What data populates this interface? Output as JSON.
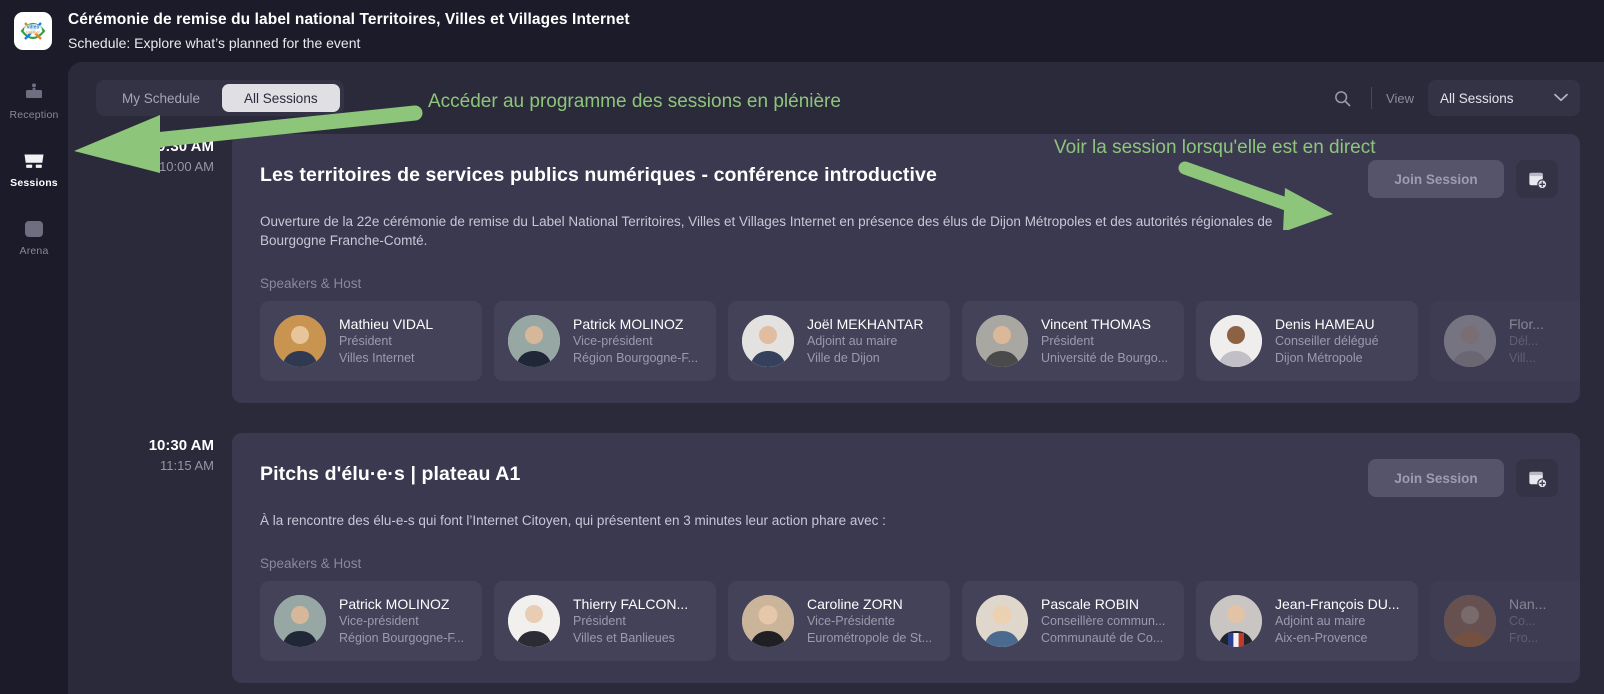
{
  "header": {
    "title": "Cérémonie de remise du label national Territoires, Villes et Villages Internet",
    "subtitle": "Schedule: Explore what’s planned for the event",
    "logo_alt": "villes-internet-logo"
  },
  "sidebar": {
    "items": [
      {
        "label": "Reception",
        "icon": "reception-desk-icon",
        "active": false
      },
      {
        "label": "Sessions",
        "icon": "presentation-screen-icon",
        "active": true
      },
      {
        "label": "Arena",
        "icon": "arena-icon",
        "active": false
      }
    ]
  },
  "toolbar": {
    "tabs": [
      {
        "label": "My Schedule",
        "active": false
      },
      {
        "label": "All Sessions",
        "active": true
      }
    ],
    "search_icon": "search-icon",
    "view_label": "View",
    "view_select": {
      "value": "All Sessions",
      "options": [
        "All Sessions"
      ]
    }
  },
  "annotations": [
    {
      "text": "Accéder au programme des sessions en plénière",
      "color": "#8dc57a"
    },
    {
      "text": "Voir la session lorsqu'elle est en direct",
      "color": "#8dc57a"
    }
  ],
  "sessions": [
    {
      "start_time": "09:30 AM",
      "end_time": "10:00 AM",
      "title": "Les territoires de services publics numériques - conférence introductive",
      "description": "Ouverture de la 22e cérémonie de remise du Label National Territoires, Villes et Villages Internet en présence des élus de Dijon Métropoles et des autorités régionales de Bourgogne Franche-Comté.",
      "join_label": "Join Session",
      "calendar_icon": "calendar-add-icon",
      "speakers_label": "Speakers & Host",
      "speakers": [
        {
          "name": "Mathieu VIDAL",
          "role": "Président",
          "org": "Villes Internet",
          "avatar": "#c9944f"
        },
        {
          "name": "Patrick MOLINOZ",
          "role": "Vice-président",
          "org": "Région Bourgogne-F...",
          "avatar": "#97a8a4"
        },
        {
          "name": "Joël MEKHANTAR",
          "role": "Adjoint au maire",
          "org": "Ville de Dijon",
          "avatar": "#e4e2e0"
        },
        {
          "name": "Vincent THOMAS",
          "role": "Président",
          "org": "Université de Bourgo...",
          "avatar": "#a9a7a2"
        },
        {
          "name": "Denis HAMEAU",
          "role": "Conseiller délégué",
          "org": "Dijon Métropole",
          "avatar": "#f0eeec"
        },
        {
          "name": "Flor...",
          "role": "Dél...",
          "org": "Vill...",
          "avatar": "#d9d4cf"
        }
      ]
    },
    {
      "start_time": "10:30 AM",
      "end_time": "11:15 AM",
      "title": "Pitchs d'élu·e·s | plateau A1",
      "description": "À la rencontre des élu-e-s qui font l’Internet Citoyen, qui présentent en 3 minutes leur action phare avec :",
      "join_label": "Join Session",
      "calendar_icon": "calendar-add-icon",
      "speakers_label": "Speakers & Host",
      "speakers": [
        {
          "name": "Patrick MOLINOZ",
          "role": "Vice-président",
          "org": "Région Bourgogne-F...",
          "avatar": "#97a8a4"
        },
        {
          "name": "Thierry FALCON...",
          "role": "Président",
          "org": "Villes et Banlieues",
          "avatar": "#f2f0ee"
        },
        {
          "name": "Caroline ZORN",
          "role": "Vice-Présidente",
          "org": "Eurométropole de St...",
          "avatar": "#cbb59a"
        },
        {
          "name": "Pascale ROBIN",
          "role": "Conseillère commun...",
          "org": "Communauté de Co...",
          "avatar": "#e0d7cc"
        },
        {
          "name": "Jean-François DU...",
          "role": "Adjoint au maire",
          "org": "Aix-en-Provence",
          "avatar": "#c8c5c2"
        },
        {
          "name": "Nan...",
          "role": "Co...",
          "org": "Fro...",
          "avatar": "#b07a52"
        }
      ]
    }
  ]
}
